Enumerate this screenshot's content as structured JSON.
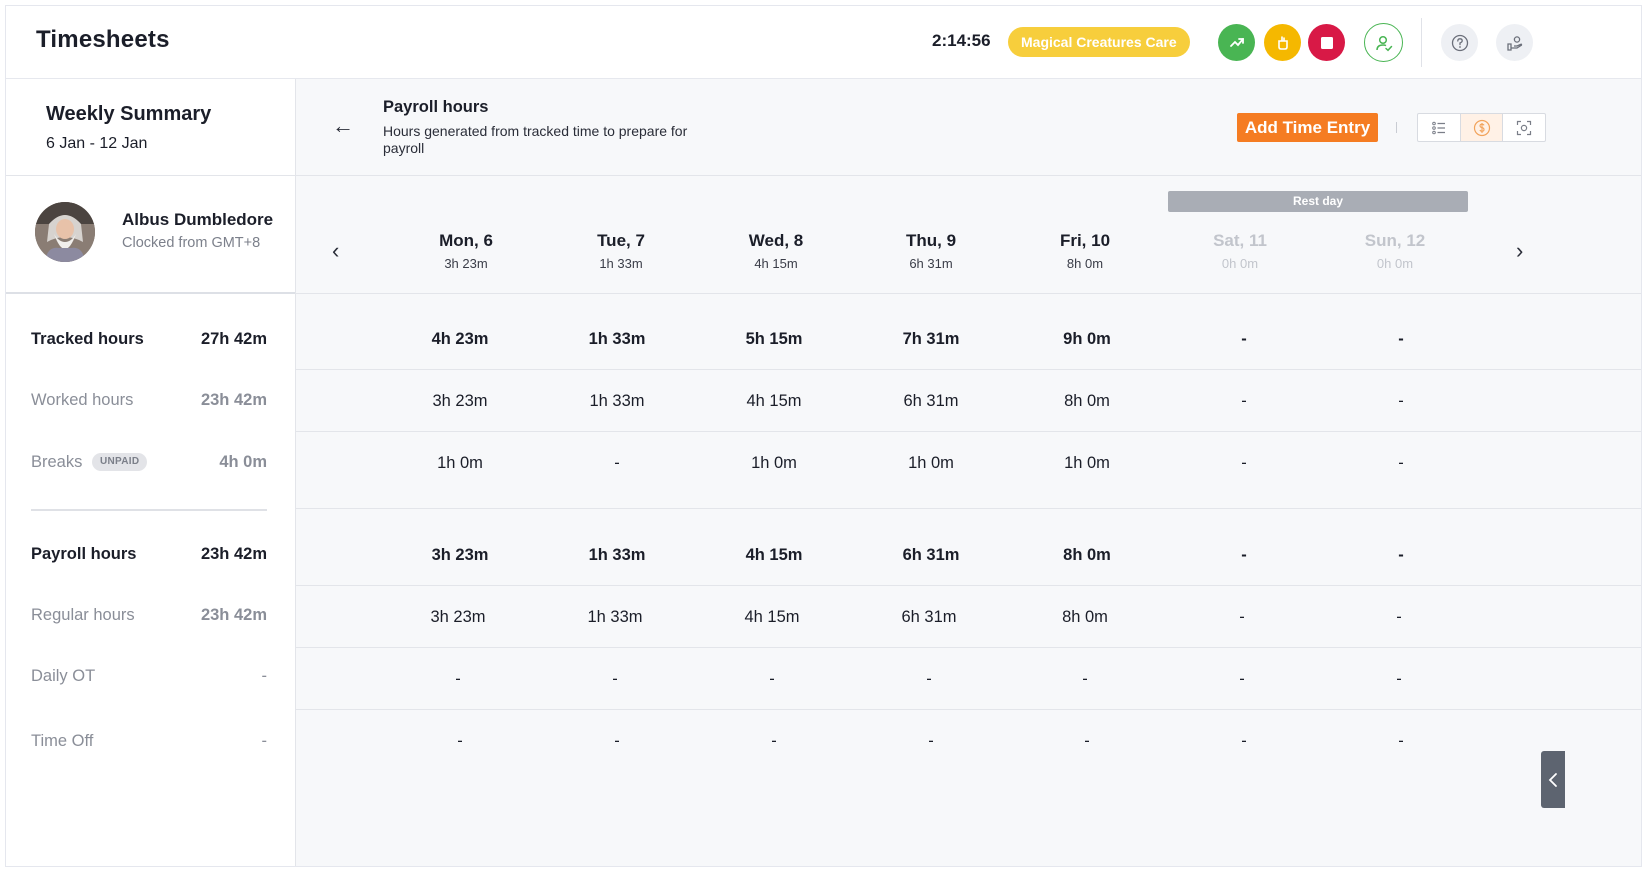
{
  "header": {
    "title": "Timesheets",
    "timer": "2:14:56",
    "project": "Magical Creatures Care",
    "icons": [
      "switch-task-icon",
      "break-icon",
      "stop-icon",
      "user-check-icon",
      "help-icon",
      "team-icon"
    ],
    "colors": {
      "project": "#f7ce3c",
      "green": "#49b553",
      "yellow": "#f5b800",
      "red": "#d81946"
    }
  },
  "summary": {
    "title": "Weekly Summary",
    "range": "6 Jan - 12 Jan",
    "user": {
      "name": "Albus Dumbledore",
      "timezone": "Clocked from GMT+8"
    },
    "rows": [
      {
        "label": "Tracked hours",
        "value": "27h 42m"
      },
      {
        "label": "Worked hours",
        "value": "23h 42m"
      },
      {
        "label": "Breaks",
        "badge": "UNPAID",
        "value": "4h 0m"
      },
      {
        "label": "Payroll hours",
        "value": "23h 42m"
      },
      {
        "label": "Regular hours",
        "value": "23h 42m"
      },
      {
        "label": "Daily OT",
        "value": "-"
      },
      {
        "label": "Time Off",
        "value": "-"
      }
    ]
  },
  "main": {
    "title": "Payroll hours",
    "description": "Hours generated from tracked time to prepare for payroll",
    "add_button": "Add Time Entry",
    "accent": "#f57c22",
    "rest_day": "Rest day",
    "days": [
      {
        "name": "Mon, 6",
        "hours": "3h 23m"
      },
      {
        "name": "Tue, 7",
        "hours": "1h 33m"
      },
      {
        "name": "Wed, 8",
        "hours": "4h 15m"
      },
      {
        "name": "Thu, 9",
        "hours": "6h 31m"
      },
      {
        "name": "Fri, 10",
        "hours": "8h 0m"
      },
      {
        "name": "Sat, 11",
        "hours": "0h 0m"
      },
      {
        "name": "Sun, 12",
        "hours": "0h 0m"
      }
    ],
    "rows": [
      [
        "4h 23m",
        "1h 33m",
        "5h 15m",
        "7h 31m",
        "9h 0m",
        "-",
        "-"
      ],
      [
        "3h 23m",
        "1h 33m",
        "4h 15m",
        "6h 31m",
        "8h 0m",
        "-",
        "-"
      ],
      [
        "1h 0m",
        "-",
        "1h 0m",
        "1h 0m",
        "1h 0m",
        "-",
        "-"
      ],
      [
        "3h 23m",
        "1h 33m",
        "4h 15m",
        "6h 31m",
        "8h 0m",
        "-",
        "-"
      ],
      [
        "3h 23m",
        "1h 33m",
        "4h 15m",
        "6h 31m",
        "8h 0m",
        "-",
        "-"
      ],
      [
        "-",
        "-",
        "-",
        "-",
        "-",
        "-",
        "-"
      ],
      [
        "-",
        "-",
        "-",
        "-",
        "-",
        "-",
        "-"
      ]
    ]
  }
}
